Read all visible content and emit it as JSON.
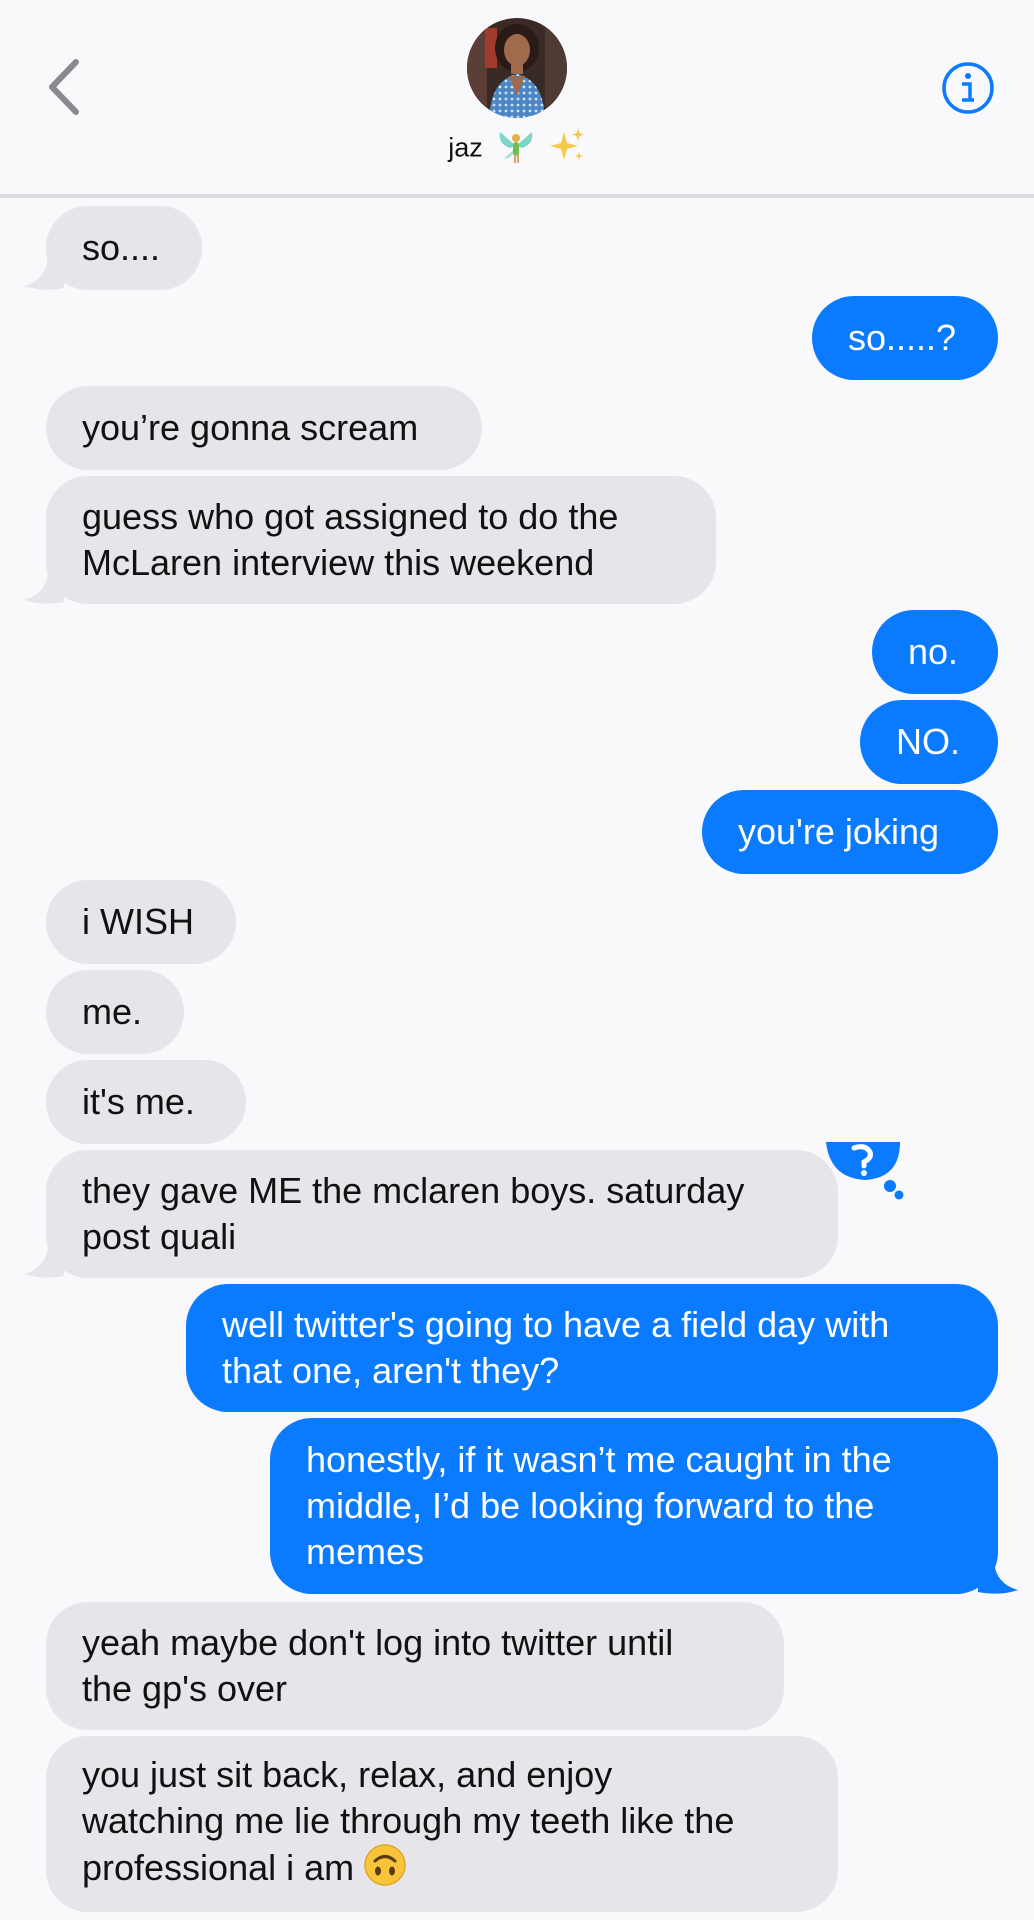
{
  "header": {
    "contact_name": "jaz",
    "contact_emoji_icons": [
      "fairy-emoji",
      "sparkles-emoji"
    ],
    "back_icon": "chevron-left-icon",
    "info_icon": "info-icon",
    "accent_color": "#0a7bfe"
  },
  "messages": [
    {
      "dir": "in",
      "text": "so....",
      "tail": true
    },
    {
      "dir": "out",
      "text": "so.....?",
      "tail": false
    },
    {
      "dir": "in",
      "text": "you’re gonna scream",
      "tail": false
    },
    {
      "dir": "in",
      "text": "guess who got assigned to do the\nMcLaren interview this weekend",
      "tail": true
    },
    {
      "dir": "out",
      "text": "no.",
      "tail": false
    },
    {
      "dir": "out",
      "text": "NO.",
      "tail": false
    },
    {
      "dir": "out",
      "text": "you're joking",
      "tail": false
    },
    {
      "dir": "in",
      "text": "i WISH",
      "tail": false
    },
    {
      "dir": "in",
      "text": "me.",
      "tail": false
    },
    {
      "dir": "in",
      "text": "it's me.",
      "tail": false
    },
    {
      "dir": "in",
      "text": "they gave ME the mclaren boys. saturday\npost quali",
      "tail": true,
      "tapback": "question-mark-tapback-icon"
    },
    {
      "dir": "out",
      "text": "well twitter's going to have a field day with\nthat one, aren't they?",
      "tail": false
    },
    {
      "dir": "out",
      "text": "honestly, if it wasn’t me caught in the\nmiddle, I’d be looking forward to the\nmemes",
      "tail": true
    },
    {
      "dir": "in",
      "text": "yeah maybe don't log into twitter until\nthe gp's over",
      "tail": false
    },
    {
      "dir": "in",
      "text": "you just sit back, relax, and enjoy\nwatching me lie through my teeth like the\nprofessional i am",
      "tail": false,
      "emoji": "upside-down-face-emoji"
    }
  ]
}
